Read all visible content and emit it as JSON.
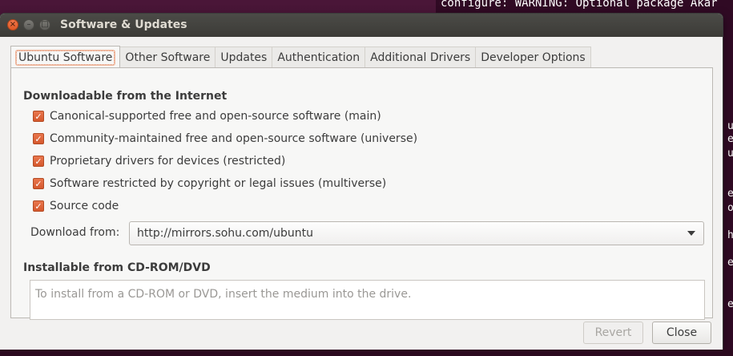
{
  "terminal": {
    "line1": "configure: WARNING: Optional package Akar",
    "fragments": [
      "us",
      "eT",
      "u",
      "e/",
      "o",
      "he",
      "e",
      "e"
    ]
  },
  "window": {
    "title": "Software & Updates",
    "close_icon": "×",
    "minimize_icon": "–",
    "maximize_icon": "□"
  },
  "tabs": [
    {
      "label": "Ubuntu Software",
      "active": true
    },
    {
      "label": "Other Software",
      "active": false
    },
    {
      "label": "Updates",
      "active": false
    },
    {
      "label": "Authentication",
      "active": false
    },
    {
      "label": "Additional Drivers",
      "active": false
    },
    {
      "label": "Developer Options",
      "active": false
    }
  ],
  "internet": {
    "title": "Downloadable from the Internet",
    "options": [
      {
        "label": "Canonical-supported free and open-source software (main)",
        "checked": true
      },
      {
        "label": "Community-maintained free and open-source software (universe)",
        "checked": true
      },
      {
        "label": "Proprietary drivers for devices (restricted)",
        "checked": true
      },
      {
        "label": "Software restricted by copyright or legal issues (multiverse)",
        "checked": true
      },
      {
        "label": "Source code",
        "checked": true
      }
    ],
    "download_from_label": "Download from:",
    "download_from_value": "http://mirrors.sohu.com/ubuntu"
  },
  "cdrom": {
    "title": "Installable from CD-ROM/DVD",
    "placeholder": "To install from a CD-ROM or DVD, insert the medium into the drive."
  },
  "buttons": {
    "revert": "Revert",
    "close": "Close"
  },
  "colors": {
    "accent": "#dd5a2a",
    "titlebar": "#3c3b37",
    "window_bg": "#f2f1f0"
  },
  "check_glyph": "✓"
}
